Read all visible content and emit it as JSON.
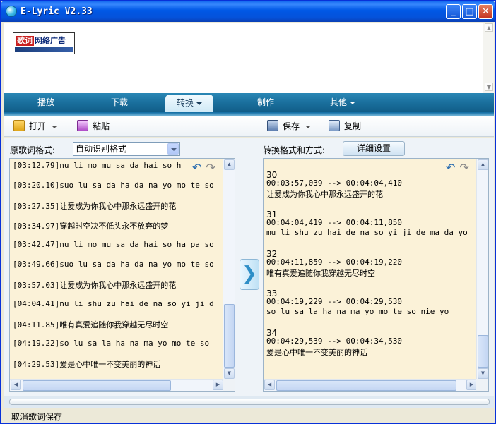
{
  "window": {
    "title": "E-Lyric V2.33"
  },
  "title_buttons": {
    "minimize": "_",
    "maximize": "□",
    "close": "✕"
  },
  "ad": {
    "red_text": "歌词",
    "text": "网络广告"
  },
  "tabs": [
    {
      "label": "播放"
    },
    {
      "label": "下载"
    },
    {
      "label": "转换",
      "active": true
    },
    {
      "label": "制作"
    },
    {
      "label": "其他"
    }
  ],
  "toolbar": {
    "open": "打开",
    "paste": "粘贴",
    "save": "保存",
    "copy": "复制"
  },
  "source": {
    "label": "原歌词格式:",
    "format_value": "自动识别格式"
  },
  "target": {
    "label": "转换格式和方式:",
    "detail_button": "详细设置"
  },
  "left_lines": [
    "[03:12.79]nu li mo mu sa da hai so h",
    "[03:20.10]suo lu sa da ha da na yo mo te so",
    "[03:27.35]让爱成为你我心中那永远盛开的花",
    "[03:34.97]穿越时空决不低头永不放弃的梦",
    "[03:42.47]nu li mo mu sa da hai so ha pa so",
    "[03:49.66]suo lu sa da ha da na yo mo te so",
    "[03:57.03]让爱成为你我心中那永远盛开的花",
    "[04:04.41]nu li shu zu hai de na so yi ji d",
    "[04:11.85]唯有真爱追随你我穿越无尽时空",
    "[04:19.22]so lu sa la ha na ma yo mo te so",
    "[04:29.53]爱是心中唯一不变美丽的神话"
  ],
  "right_entries": [
    {
      "index": "30",
      "time": "00:03:57,039 --> 00:04:04,410",
      "text": "让爱成为你我心中那永远盛开的花"
    },
    {
      "index": "31",
      "time": "00:04:04,419 --> 00:04:11,850",
      "text": "mu li shu zu hai de na so yi ji de ma da yo"
    },
    {
      "index": "32",
      "time": "00:04:11,859 --> 00:04:19,220",
      "text": "唯有真爱追随你我穿越无尽时空"
    },
    {
      "index": "33",
      "time": "00:04:19,229 --> 00:04:29,530",
      "text": "so lu sa la ha na ma yo mo te so nie yo"
    },
    {
      "index": "34",
      "time": "00:04:29,539 --> 00:04:34,530",
      "text": "爱是心中唯一不变美丽的神话"
    }
  ],
  "convert_arrow": "❯",
  "status": {
    "text": "取消歌词保存"
  }
}
